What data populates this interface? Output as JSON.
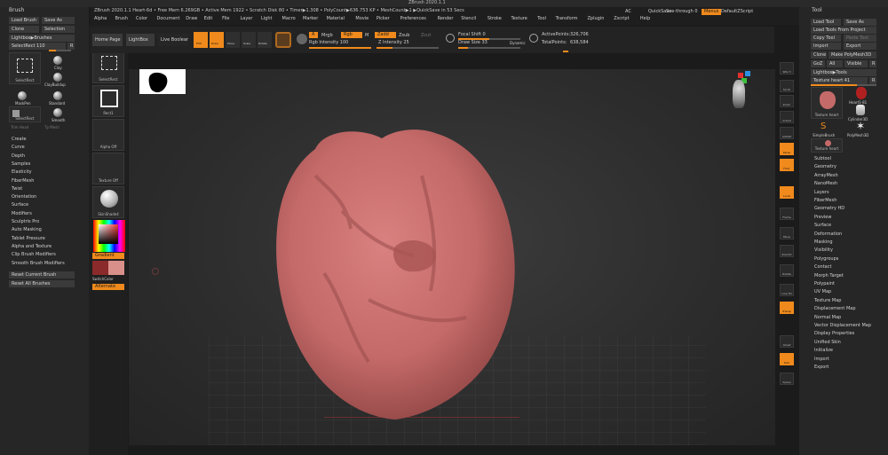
{
  "window": {
    "title": "ZBrush 2020.1.1"
  },
  "menubar": {
    "items": [
      "Alpha",
      "Brush",
      "Color",
      "Document",
      "Draw",
      "Edit",
      "File",
      "Layer",
      "Light",
      "Macro",
      "Marker",
      "Material",
      "Movie",
      "Picker",
      "Preferences",
      "Render",
      "Stencil",
      "Stroke",
      "Texture",
      "Tool",
      "Transform",
      "Zplugin",
      "Zscript",
      "Help"
    ],
    "status": "ZBrush 2020.1.1 Heart-6d  • Free Mem 6.269GB • Active Mem 1922 • Scratch Disk 80 • Timer▶1.308 • PolyCount▶636.753 KP • MeshCount▶1  ▶QuickSave in 53 Secs",
    "ac": "AC",
    "quicksave": "QuickSave",
    "seethrough": "See-through  0",
    "menus": "Menus",
    "defaultzscript": "DefaultZScript"
  },
  "left_palette": {
    "title": "Brush",
    "load_brush": "Load Brush",
    "save_as": "Save As",
    "clone": "Clone",
    "selection": "Selection",
    "lightbox_brushes": "Lightbox▶Brushes",
    "select_rect_value": "SelectRect  110",
    "r": "R",
    "brushes": [
      {
        "label": "SelectRect"
      },
      {
        "label": "Clay"
      },
      {
        "label": "ClayBuildup"
      },
      {
        "label": "Standard"
      },
      {
        "label": "MaskPen"
      },
      {
        "label": "SelectRect"
      },
      {
        "label": "Smooth"
      }
    ],
    "trim_head": "Trim Head",
    "tp_mesh": "Tp Mesh",
    "sections": [
      "Create",
      "Curve",
      "Depth",
      "Samples",
      "Elasticity",
      "FiberMesh",
      "Twist",
      "Orientation",
      "Surface",
      "Modifiers",
      "Sculptris Pro",
      "Auto Masking",
      "Tablet Pressure",
      "Alpha and Texture",
      "Clip Brush Modifiers",
      "Smooth Brush Modifiers"
    ],
    "reset_current": "Reset Current Brush",
    "reset_all": "Reset All Brushes"
  },
  "left_shelf": {
    "select_rect": "SelectRect",
    "rect1": "Rect1",
    "alpha_off": "Alpha  Off",
    "texture_off": "Texture  Off",
    "material": "SkinShade4",
    "gradient": "Gradient",
    "switch_color": "SwitchColor",
    "alternate": "Alternate",
    "main_color": "#8a2a2a",
    "secondary_color": "#d9908a"
  },
  "top_shelf": {
    "home_page": "Home Page",
    "lightbox": "LightBox",
    "live_boolean": "Live Boolean",
    "edit": "Edit",
    "draw": "Draw",
    "move": "Move",
    "scale": "Scale",
    "rotate": "Rotate",
    "a": "A",
    "mrgb": "Mrgb",
    "rgb": "Rgb",
    "m": "M",
    "zadd": "Zadd",
    "zsub": "Zsub",
    "zcut": "Zcut",
    "rgb_intensity": "Rgb Intensity  100",
    "z_intensity": "Z Intensity  25",
    "focal_shift": "Focal Shift  0",
    "draw_size": "Draw Size  33",
    "dynamic": "Dynamic",
    "active_points_label": "ActivePoints:",
    "active_points": "326,706",
    "total_points_label": "TotalPoints:",
    "total_points": "638,584"
  },
  "right_shelf": [
    "SPix 3",
    "Scroll",
    "Zoom",
    "Actual",
    "AAHalf",
    "Persp",
    "Floor",
    "Local",
    "Frame",
    "Move",
    "ZoomD",
    "Rotate",
    "Line Fill",
    "Transp",
    "Ghost",
    "Solo",
    "Xpose"
  ],
  "right_palette": {
    "title": "Tool",
    "load_tool": "Load Tool",
    "save_as": "Save As",
    "load_from_project": "Load Tools From Project",
    "copy_tool": "Copy Tool",
    "paste_tool": "Paste Tool",
    "import": "Import",
    "export": "Export",
    "clone": "Clone",
    "make_polymesh": "Make PolyMesh3D",
    "goz": "GoZ",
    "all": "All",
    "visible": "Visible",
    "r": "R",
    "lightbox_tools": "Lightbox▶Tools",
    "current_tool": "Texture heart  41",
    "tools": [
      {
        "label": "Texture heart"
      },
      {
        "label": "Heart1-81"
      },
      {
        "label": "Cylinder3D"
      },
      {
        "label": "SimpleBrush"
      },
      {
        "label": "PolyMesh3D"
      },
      {
        "label": "Texture heart"
      }
    ],
    "sections": [
      "Subtool",
      "Geometry",
      "ArrayMesh",
      "NanoMesh",
      "Layers",
      "FiberMesh",
      "Geometry HD",
      "Preview",
      "Surface",
      "Deformation",
      "Masking",
      "Visibility",
      "Polygroups",
      "Contact",
      "Morph Target",
      "Polypaint",
      "UV Map",
      "Texture Map",
      "Displacement Map",
      "Normal Map",
      "Vector Displacement Map",
      "Display Properties",
      "Unified Skin",
      "Initialize",
      "Import",
      "Export"
    ]
  },
  "colors": {
    "accent": "#f08a1c",
    "mesh": "#c9706e",
    "canvas_bg": "#2c2c2c"
  }
}
